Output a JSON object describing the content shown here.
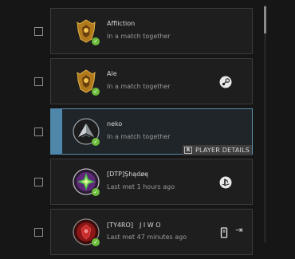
{
  "players": [
    {
      "name": "Affliction",
      "status": "In a match together",
      "avatar_icon": "gold-crest-emblem-icon",
      "online": true,
      "platform_icon": "",
      "selected": false
    },
    {
      "name": "Ale",
      "status": "In a match together",
      "avatar_icon": "gold-crest-emblem-icon",
      "online": true,
      "platform_icon": "steam-icon",
      "selected": false
    },
    {
      "name": "neko",
      "status": "In a match together",
      "avatar_icon": "silver-arrow-emblem-icon",
      "online": true,
      "platform_icon": "",
      "selected": true
    },
    {
      "name": "[DTP]Şhądøę",
      "status": "Last met 1 hours ago",
      "avatar_icon": "purple-green-emblem-icon",
      "online": true,
      "platform_icon": "playstation-icon",
      "selected": false
    },
    {
      "name": "[TY4RO]　J I W O",
      "status": "Last met 47 minutes ago",
      "avatar_icon": "red-emblem-icon",
      "online": true,
      "platform_icon": "device-icon",
      "selected": false
    }
  ],
  "player_details": {
    "key": "R",
    "label": "PLAYER DETAILS"
  },
  "colors": {
    "accent": "#4f87aa",
    "online_badge": "#6bbd3a",
    "background": "#161616"
  }
}
